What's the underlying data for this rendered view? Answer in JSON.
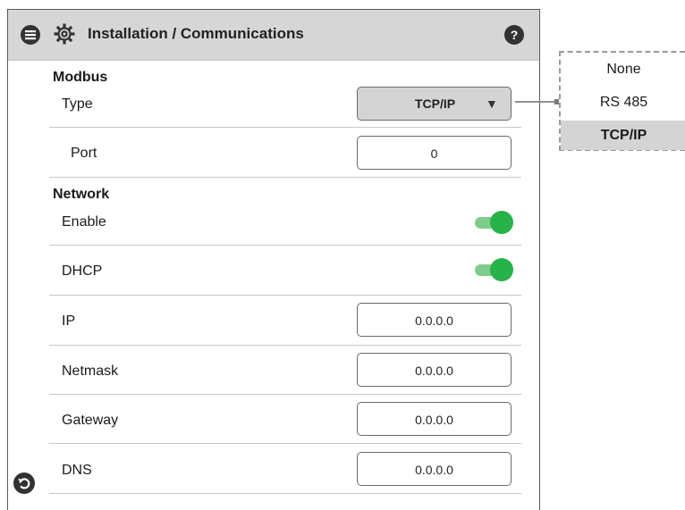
{
  "header": {
    "title": "Installation / Communications",
    "menu_icon": "menu-icon",
    "settings_icon": "gear-icon",
    "help_icon": "help-icon"
  },
  "modbus": {
    "section_title": "Modbus",
    "type_label": "Type",
    "type_value": "TCP/IP",
    "port_label": "Port",
    "port_value": "0"
  },
  "network": {
    "section_title": "Network",
    "enable_label": "Enable",
    "enable_on": true,
    "dhcp_label": "DHCP",
    "dhcp_on": true,
    "ip_label": "IP",
    "ip_value": "0.0.0.0",
    "netmask_label": "Netmask",
    "netmask_value": "0.0.0.0",
    "gateway_label": "Gateway",
    "gateway_value": "0.0.0.0",
    "dns_label": "DNS",
    "dns_value": "0.0.0.0"
  },
  "type_dropdown": {
    "options": [
      "None",
      "RS 485",
      "TCP/IP"
    ],
    "selected": "TCP/IP"
  },
  "colors": {
    "header_bg": "#d6d6d6",
    "toggle_on": "#27b24a",
    "toggle_track": "#7ecb8b"
  }
}
